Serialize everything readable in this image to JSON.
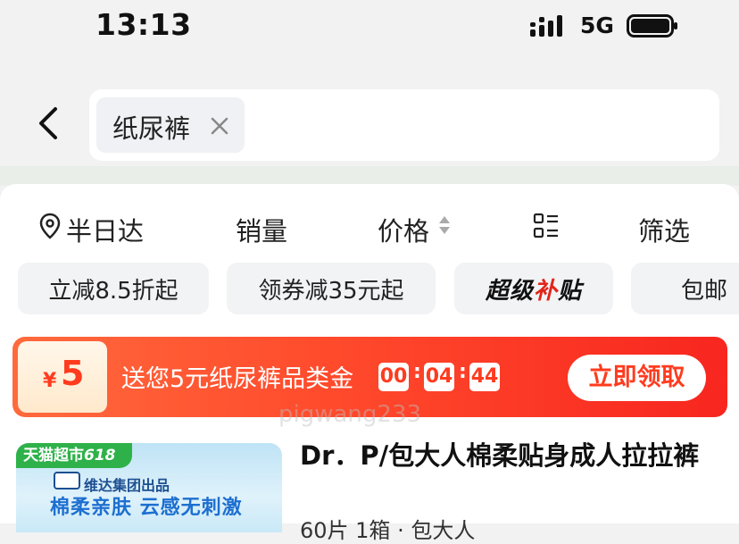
{
  "status_bar": {
    "time": "13:13",
    "network": "5G"
  },
  "search": {
    "chip_text": "纸尿裤"
  },
  "sort_bar": {
    "location_label": "半日达",
    "sales_label": "销量",
    "price_label": "价格",
    "filter_label": "筛选"
  },
  "filter_chips": [
    {
      "label": "立减8.5折起"
    },
    {
      "label": "领券减35元起"
    },
    {
      "label_main": "超级",
      "label_accent": "补",
      "label_tail": "贴"
    },
    {
      "label": "包邮"
    }
  ],
  "promo": {
    "coupon_symbol": "¥",
    "coupon_amount": "5",
    "text": "送您5元纸尿裤品类金",
    "timer": [
      "00",
      "04",
      "44"
    ],
    "claim_label": "立即领取",
    "colors": {
      "start": "#ff6a3d",
      "end": "#f8261f",
      "accent": "#ff3b1f"
    }
  },
  "product": {
    "store_tag": "天猫超市",
    "store_tag_num": "618",
    "brand_line": "维达集团出品",
    "slogan": "棉柔亲肤 云感无刺激",
    "title": "Dr．P/包大人棉柔贴身成人拉拉裤",
    "subtitle": "60片 1箱 · 包大人"
  },
  "watermark": "pigwang233"
}
